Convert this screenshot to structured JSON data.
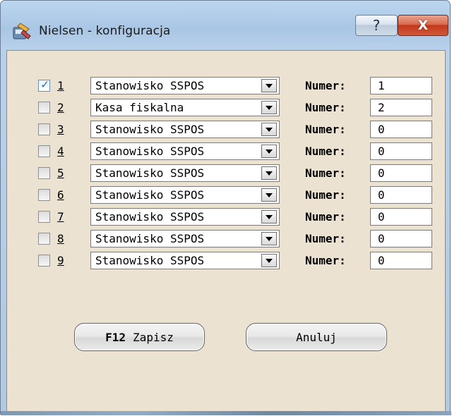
{
  "window": {
    "title": "Nielsen - konfiguracja",
    "help_glyph": "?",
    "close_glyph": "X"
  },
  "rows": [
    {
      "checked": true,
      "number": "1",
      "combo": "Stanowisko SSPOS",
      "numer_label": "Numer:",
      "numer_value": "1"
    },
    {
      "checked": false,
      "number": "2",
      "combo": "Kasa fiskalna",
      "numer_label": "Numer:",
      "numer_value": "2"
    },
    {
      "checked": false,
      "number": "3",
      "combo": "Stanowisko SSPOS",
      "numer_label": "Numer:",
      "numer_value": "0"
    },
    {
      "checked": false,
      "number": "4",
      "combo": "Stanowisko SSPOS",
      "numer_label": "Numer:",
      "numer_value": "0"
    },
    {
      "checked": false,
      "number": "5",
      "combo": "Stanowisko SSPOS",
      "numer_label": "Numer:",
      "numer_value": "0"
    },
    {
      "checked": false,
      "number": "6",
      "combo": "Stanowisko SSPOS",
      "numer_label": "Numer:",
      "numer_value": "0"
    },
    {
      "checked": false,
      "number": "7",
      "combo": "Stanowisko SSPOS",
      "numer_label": "Numer:",
      "numer_value": "0"
    },
    {
      "checked": false,
      "number": "8",
      "combo": "Stanowisko SSPOS",
      "numer_label": "Numer:",
      "numer_value": "0"
    },
    {
      "checked": false,
      "number": "9",
      "combo": "Stanowisko SSPOS",
      "numer_label": "Numer:",
      "numer_value": "0"
    }
  ],
  "buttons": {
    "save_key": "F12",
    "save_label": "Zapisz",
    "cancel_label": "Anuluj"
  },
  "check_glyph": "✓"
}
